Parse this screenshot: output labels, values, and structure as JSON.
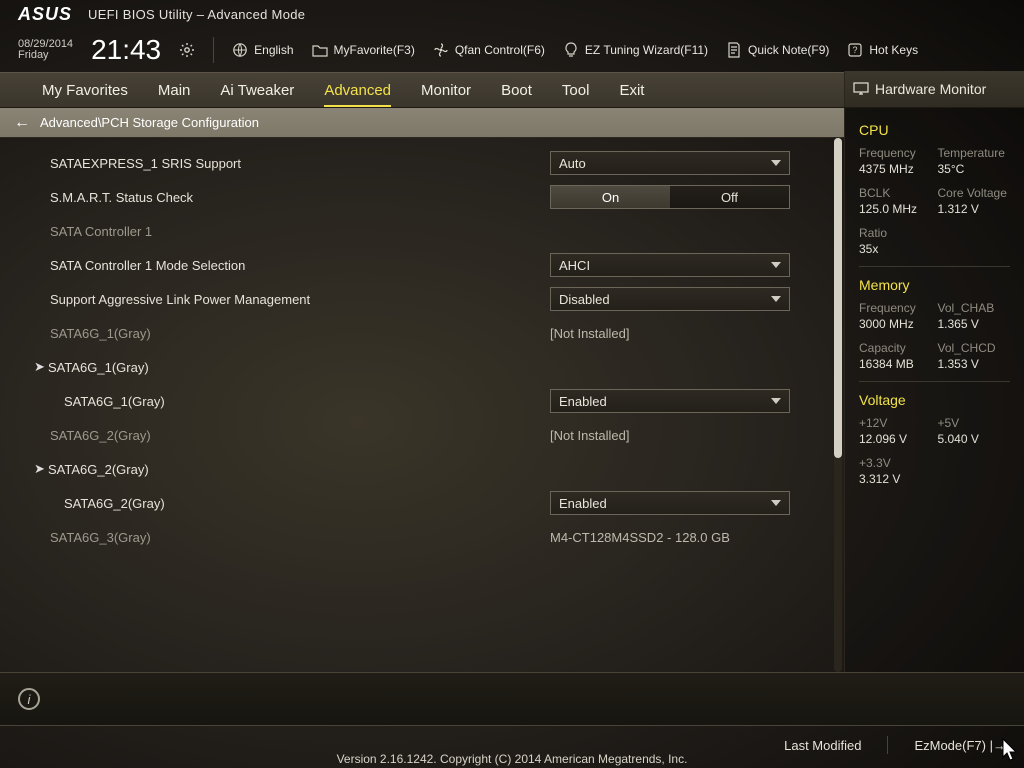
{
  "app": {
    "brand": "ASUS",
    "title": "UEFI BIOS Utility – Advanced Mode"
  },
  "datetime": {
    "date": "08/29/2014",
    "day": "Friday",
    "time": "21:43"
  },
  "toolbar": {
    "language": "English",
    "myfavorite": "MyFavorite(F3)",
    "qfan": "Qfan Control(F6)",
    "eztuning": "EZ Tuning Wizard(F11)",
    "quicknote": "Quick Note(F9)",
    "hotkeys": "Hot Keys"
  },
  "menu": {
    "tabs": [
      "My Favorites",
      "Main",
      "Ai Tweaker",
      "Advanced",
      "Monitor",
      "Boot",
      "Tool",
      "Exit"
    ],
    "active": "Advanced",
    "hwmon_title": "Hardware Monitor"
  },
  "breadcrumb": {
    "path": "Advanced\\PCH Storage Configuration"
  },
  "settings": {
    "sataexpress_label": "SATAEXPRESS_1 SRIS Support",
    "sataexpress_value": "Auto",
    "smart_label": "S.M.A.R.T. Status Check",
    "smart_on": "On",
    "smart_off": "Off",
    "ctrl1_header": "SATA Controller 1",
    "ctrl1_mode_label": "SATA Controller 1 Mode Selection",
    "ctrl1_mode_value": "AHCI",
    "aggr_label": "Support Aggressive Link Power Management",
    "aggr_value": "Disabled",
    "port1_top_label": "SATA6G_1(Gray)",
    "port1_top_value": "[Not Installed]",
    "port1_expand": "SATA6G_1(Gray)",
    "port1_sub_label": "SATA6G_1(Gray)",
    "port1_sub_value": "Enabled",
    "port2_top_label": "SATA6G_2(Gray)",
    "port2_top_value": "[Not Installed]",
    "port2_expand": "SATA6G_2(Gray)",
    "port2_sub_label": "SATA6G_2(Gray)",
    "port2_sub_value": "Enabled",
    "port3_label": "SATA6G_3(Gray)",
    "port3_value": "M4-CT128M4SSD2 - 128.0 GB"
  },
  "hw": {
    "cpu_title": "CPU",
    "cpu_freq_k": "Frequency",
    "cpu_freq_v": "4375 MHz",
    "cpu_temp_k": "Temperature",
    "cpu_temp_v": "35°C",
    "bclk_k": "BCLK",
    "bclk_v": "125.0 MHz",
    "corev_k": "Core Voltage",
    "corev_v": "1.312 V",
    "ratio_k": "Ratio",
    "ratio_v": "35x",
    "mem_title": "Memory",
    "mem_freq_k": "Frequency",
    "mem_freq_v": "3000 MHz",
    "vol_chab_k": "Vol_CHAB",
    "vol_chab_v": "1.365 V",
    "cap_k": "Capacity",
    "cap_v": "16384 MB",
    "vol_chcd_k": "Vol_CHCD",
    "vol_chcd_v": "1.353 V",
    "volt_title": "Voltage",
    "v12_k": "+12V",
    "v12_v": "12.096 V",
    "v5_k": "+5V",
    "v5_v": "5.040 V",
    "v33_k": "+3.3V",
    "v33_v": "3.312 V"
  },
  "bottom": {
    "last_modified": "Last Modified",
    "ezmode": "EzMode(F7)"
  },
  "copyright": "Version 2.16.1242. Copyright (C) 2014 American Megatrends, Inc."
}
